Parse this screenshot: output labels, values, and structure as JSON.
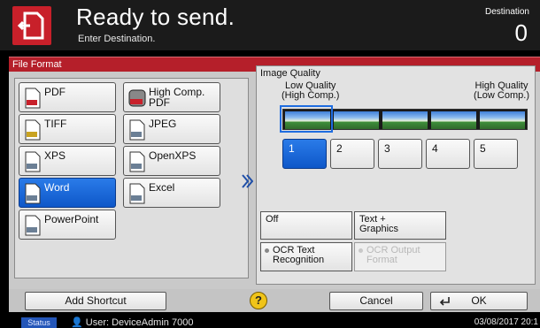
{
  "header": {
    "title": "Ready to send.",
    "subtitle": "Enter Destination.",
    "destination_label": "Destination",
    "destination_count": "0",
    "icon": "send-document-icon"
  },
  "panel": {
    "tab_label": "File Format",
    "formats": [
      {
        "label": "PDF",
        "icon": "pdf-file-icon"
      },
      {
        "label": "High Comp.\nPDF",
        "icon": "high-comp-pdf-file-icon"
      },
      {
        "label": "TIFF",
        "icon": "tiff-file-icon"
      },
      {
        "label": "JPEG",
        "icon": "jpeg-file-icon"
      },
      {
        "label": "XPS",
        "icon": "xps-file-icon"
      },
      {
        "label": "OpenXPS",
        "icon": "openxps-file-icon"
      },
      {
        "label": "Word",
        "icon": "word-file-icon",
        "selected": true
      },
      {
        "label": "Excel",
        "icon": "excel-file-icon"
      },
      {
        "label": "PowerPoint",
        "icon": "powerpoint-file-icon"
      }
    ],
    "image_quality": {
      "title": "Image Quality",
      "low_label_1": "Low Quality",
      "low_label_2": "(High Comp.)",
      "high_label_1": "High Quality",
      "high_label_2": "(Low Comp.)",
      "levels": [
        "1",
        "2",
        "3",
        "4",
        "5"
      ],
      "selected_level": "1"
    },
    "ocr": {
      "off_label": "Off",
      "text_graphics_label_1": "Text +",
      "text_graphics_label_2": "Graphics",
      "ocr_text_label_1": "OCR Text",
      "ocr_text_label_2": "Recognition",
      "ocr_output_label_1": "OCR Output",
      "ocr_output_label_2": "Format"
    }
  },
  "bottom": {
    "add_shortcut": "Add Shortcut",
    "help": "?",
    "cancel": "Cancel",
    "ok": "OK"
  },
  "status": {
    "tab": "Status",
    "user": "User: DeviceAdmin  7000",
    "date": "03/08/2017 20:1"
  },
  "colors": {
    "accent_red": "#b51f2a",
    "selected_blue": "#1664d9",
    "help_yellow": "#f0c419"
  }
}
